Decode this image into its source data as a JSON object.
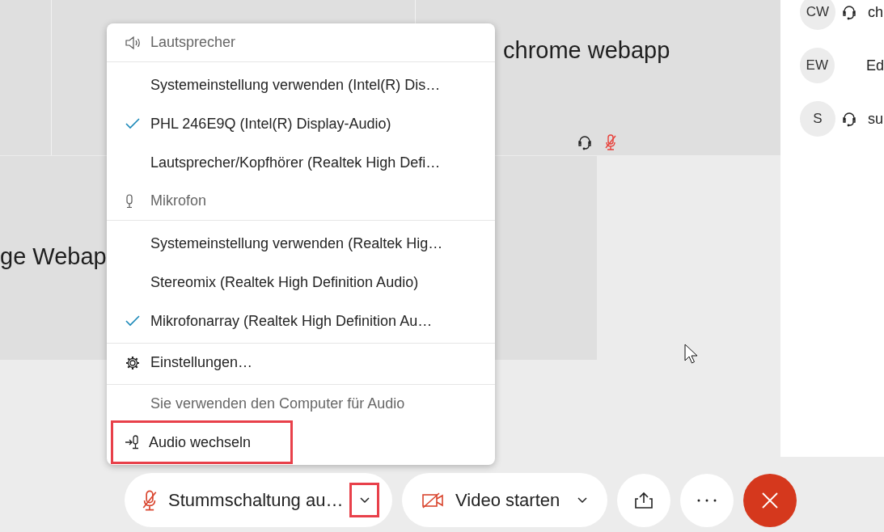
{
  "tiles": [
    {
      "label": "chrome webapp",
      "muted": true
    },
    {
      "label": "ge Webap",
      "muted": false
    }
  ],
  "participants": [
    {
      "initials": "CW",
      "name": "ch",
      "headset": true
    },
    {
      "initials": "EW",
      "name": "Ed",
      "headset": false
    },
    {
      "initials": "S",
      "name": "su",
      "headset": true
    }
  ],
  "audio_menu": [
    {
      "kind": "speaker_header",
      "label": "Lautsprecher"
    },
    {
      "kind": "device",
      "label": "Systemeinstellung verwenden (Intel(R) Dis…",
      "selected": false
    },
    {
      "kind": "device",
      "label": "PHL 246E9Q (Intel(R) Display-Audio)",
      "selected": true
    },
    {
      "kind": "device",
      "label": "Lautsprecher/Kopfhörer (Realtek High Defi…",
      "selected": false
    },
    {
      "kind": "mic_header",
      "label": "Mikrofon"
    },
    {
      "kind": "device",
      "label": "Systemeinstellung verwenden (Realtek Hig…",
      "selected": false
    },
    {
      "kind": "device",
      "label": "Stereomix (Realtek High Definition Audio)",
      "selected": false
    },
    {
      "kind": "device",
      "label": "Mikrofonarray (Realtek High Definition Au…",
      "selected": true
    },
    {
      "kind": "settings",
      "label": "Einstellungen…"
    },
    {
      "kind": "info",
      "label": "Sie verwenden den Computer für Audio"
    },
    {
      "kind": "switch",
      "label": "Audio wechseln",
      "highlighted": true
    }
  ],
  "controls": {
    "mute": {
      "label": "Stummschaltung au…",
      "menu_highlighted": true
    },
    "video": {
      "label": "Video starten"
    }
  }
}
